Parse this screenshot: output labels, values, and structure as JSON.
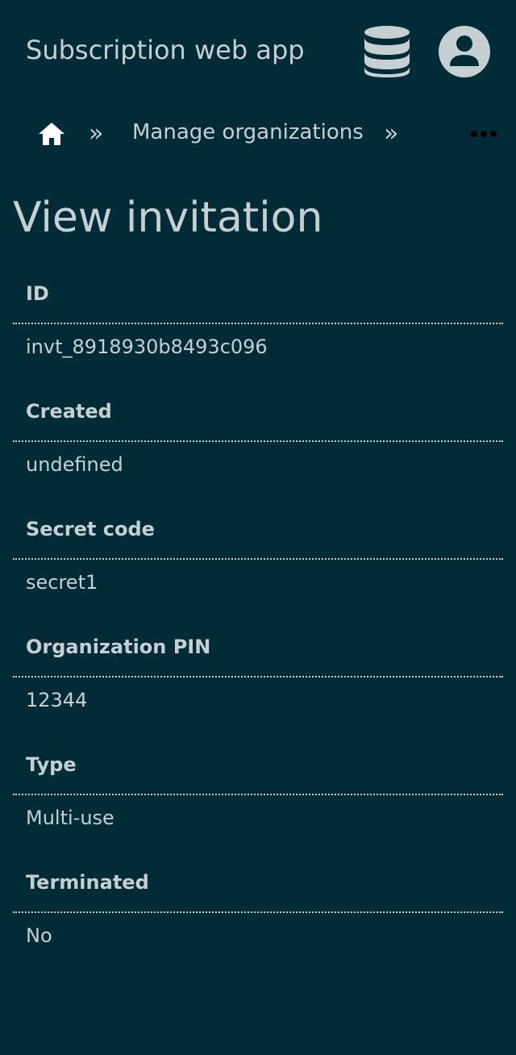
{
  "header": {
    "app_title": "Subscription web app",
    "database_icon": "database-icon",
    "account_icon": "account-circle-icon"
  },
  "breadcrumb": {
    "home_icon": "home-icon",
    "separator": "»",
    "items": [
      {
        "label": "Manage organizations"
      }
    ],
    "more_icon": "more-horizontal-icon"
  },
  "page": {
    "title": "View invitation"
  },
  "fields": [
    {
      "label": "ID",
      "value": "invt_8918930b8493c096"
    },
    {
      "label": "Created",
      "value": "undefined"
    },
    {
      "label": "Secret code",
      "value": "secret1"
    },
    {
      "label": "Organization PIN",
      "value": "12344"
    },
    {
      "label": "Type",
      "value": "Multi-use"
    },
    {
      "label": "Terminated",
      "value": "No"
    }
  ],
  "colors": {
    "background": "#022b38",
    "text": "#c6d0d3",
    "home_icon": "#ffffff",
    "more_icon": "#000000"
  }
}
